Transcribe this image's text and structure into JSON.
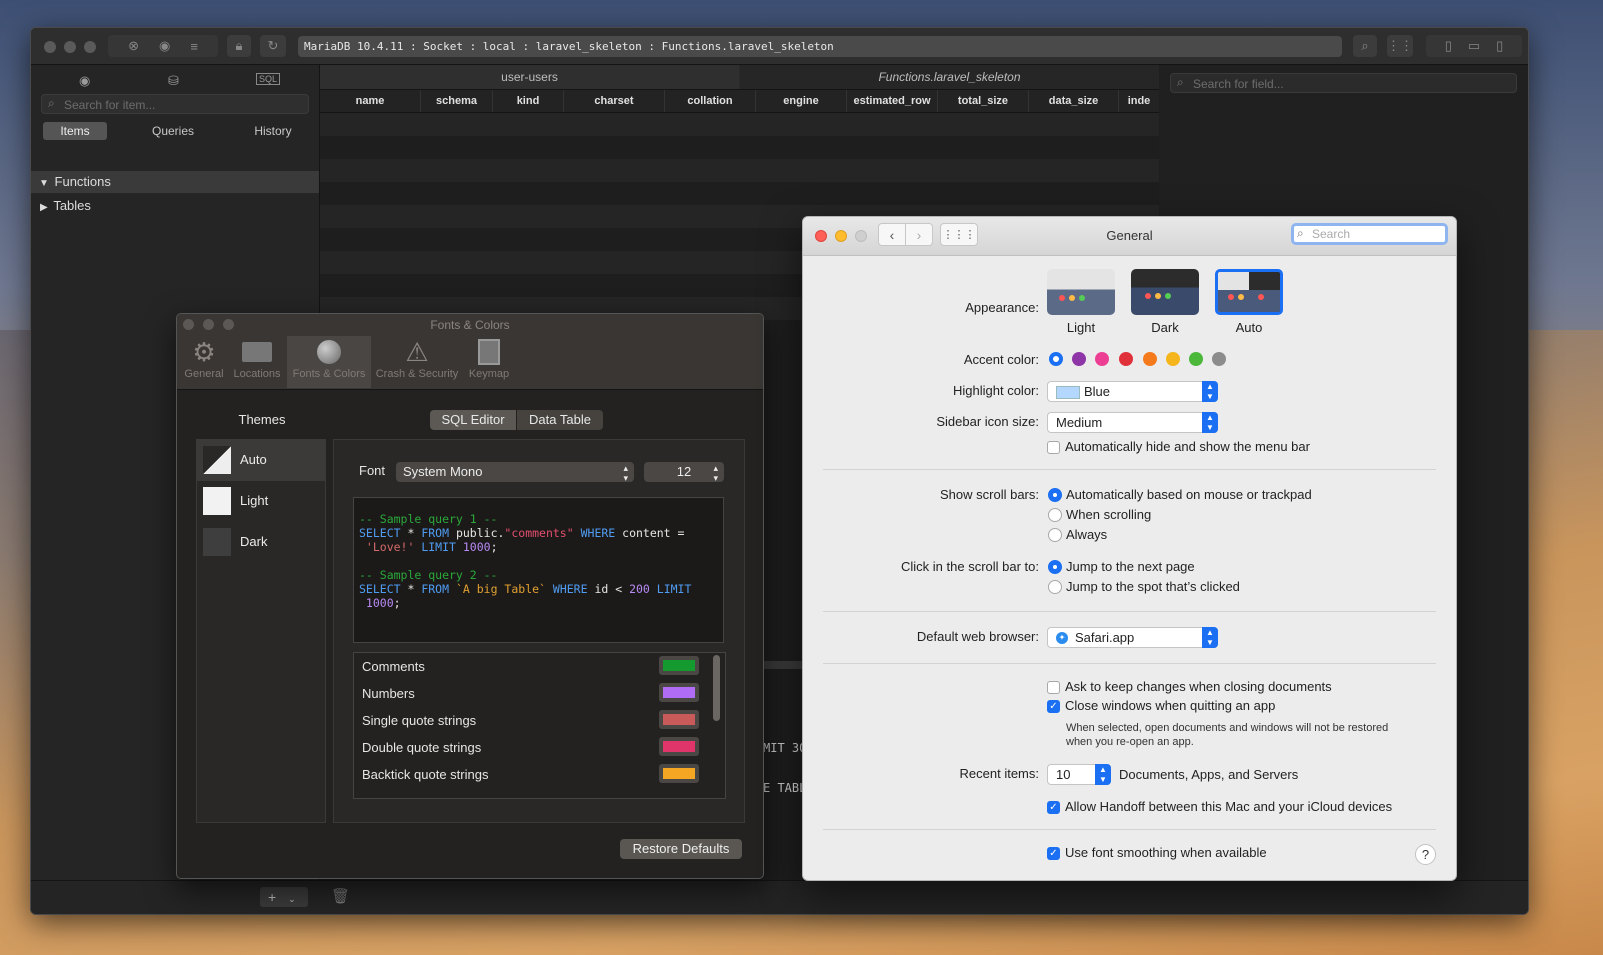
{
  "main": {
    "address": "MariaDB 10.4.11 : Socket : local : laravel_skeleton : Functions.laravel_skeleton",
    "sidebar": {
      "search_placeholder": "Search for item...",
      "segments": [
        "Items",
        "Queries",
        "History"
      ],
      "tree": [
        {
          "label": "Functions",
          "expanded": true
        },
        {
          "label": "Tables",
          "expanded": false
        }
      ]
    },
    "tabs": [
      "user-users",
      "Functions.laravel_skeleton"
    ],
    "columns": [
      "name",
      "schema",
      "kind",
      "charset",
      "collation",
      "engine",
      "estimated_row",
      "total_size",
      "data_size",
      "inde"
    ],
    "right_search_placeholder": "Search for field...",
    "console_fragments": [
      "MIT 30",
      "E TABL"
    ]
  },
  "fonts_colors": {
    "title": "Fonts & Colors",
    "toolbar": [
      {
        "label": "General",
        "icon": "gear-icon"
      },
      {
        "label": "Locations",
        "icon": "folder-icon"
      },
      {
        "label": "Fonts & Colors",
        "icon": "sphere-icon"
      },
      {
        "label": "Crash & Security",
        "icon": "warning-icon"
      },
      {
        "label": "Keymap",
        "icon": "keymap-icon"
      }
    ],
    "themes_heading": "Themes",
    "themes": [
      "Auto",
      "Light",
      "Dark"
    ],
    "segments": [
      "SQL Editor",
      "Data Table"
    ],
    "font_label": "Font",
    "font_name": "System Mono",
    "font_size": "12",
    "code": {
      "c1": "-- Sample query 1 --",
      "l1a": "SELECT",
      "l1b": " * ",
      "l1c": "FROM",
      "l1d": " public.",
      "l1e": "\"comments\"",
      "l1f": " WHERE",
      "l1g": " content =",
      "l2a": " 'Love!'",
      "l2b": " LIMIT",
      "l2c": " 1000",
      "l2d": ";",
      "c2": "-- Sample query 2 --",
      "l3a": "SELECT",
      "l3b": " * ",
      "l3c": "FROM",
      "l3d": " `A big Table`",
      "l3e": " WHERE",
      "l3f": " id < ",
      "l3g": "200",
      "l3h": " LIMIT",
      "l4a": " 1000",
      "l4b": ";"
    },
    "color_items": [
      {
        "label": "Comments",
        "color": "#159a2f"
      },
      {
        "label": "Numbers",
        "color": "#b06cf5"
      },
      {
        "label": "Single quote strings",
        "color": "#c95a5a"
      },
      {
        "label": "Double quote strings",
        "color": "#e0356b"
      },
      {
        "label": "Backtick quote strings",
        "color": "#f5a623"
      }
    ],
    "restore_label": "Restore Defaults"
  },
  "sysprefs": {
    "title": "General",
    "search_placeholder": "Search",
    "appearance_label": "Appearance:",
    "appearance_options": [
      "Light",
      "Dark",
      "Auto"
    ],
    "appearance_selected": "Auto",
    "accent_label": "Accent color:",
    "accent_colors": [
      "#1a6ff3",
      "#8e35a8",
      "#ec3f94",
      "#e0303a",
      "#f57a1c",
      "#f5b51c",
      "#4cb83a",
      "#8c8c8c"
    ],
    "highlight_label": "Highlight color:",
    "highlight_value": "Blue",
    "sidebar_icon_label": "Sidebar icon size:",
    "sidebar_icon_value": "Medium",
    "menubar_label": "Automatically hide and show the menu bar",
    "scroll_label": "Show scroll bars:",
    "scroll_options": [
      "Automatically based on mouse or trackpad",
      "When scrolling",
      "Always"
    ],
    "click_label": "Click in the scroll bar to:",
    "click_options": [
      "Jump to the next page",
      "Jump to the spot that’s clicked"
    ],
    "browser_label": "Default web browser:",
    "browser_value": "Safari.app",
    "ask_changes_label": "Ask to keep changes when closing documents",
    "close_windows_label": "Close windows when quitting an app",
    "close_windows_note_1": "When selected, open documents and windows will not be restored",
    "close_windows_note_2": "when you re-open an app.",
    "recent_label": "Recent items:",
    "recent_value": "10",
    "recent_suffix": "Documents, Apps, and Servers",
    "handoff_label": "Allow Handoff between this Mac and your iCloud devices",
    "smoothing_label": "Use font smoothing when available",
    "help_label": "?"
  }
}
